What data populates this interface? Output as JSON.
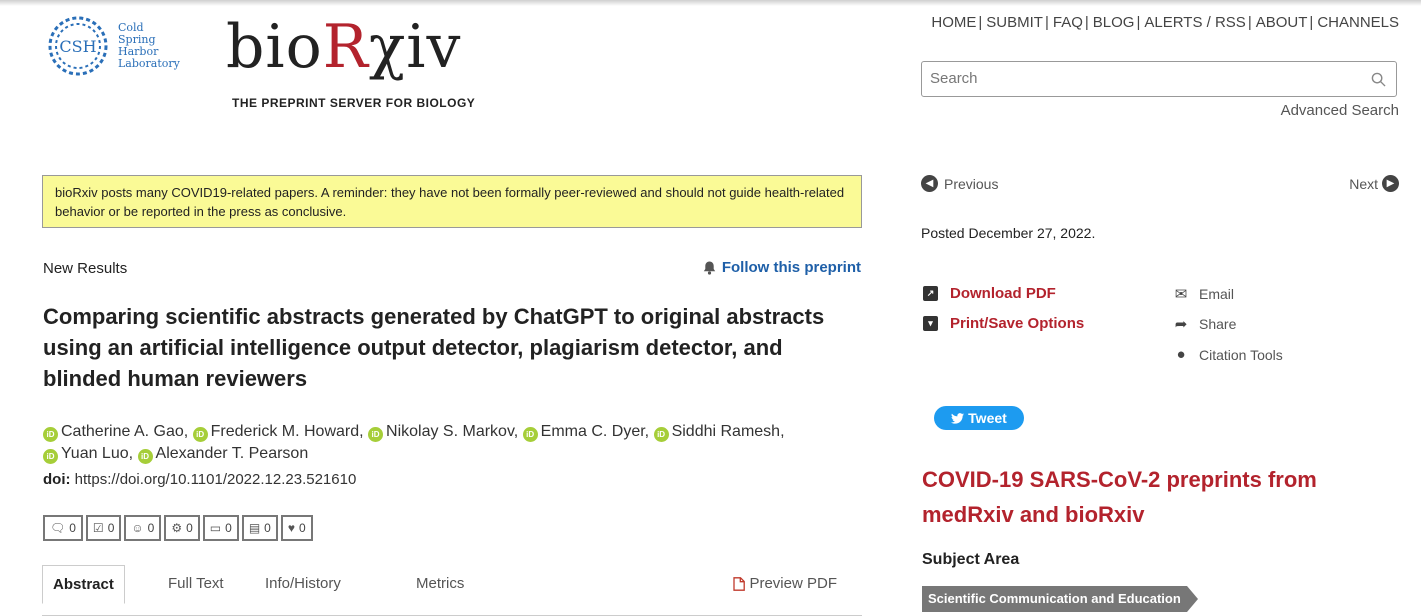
{
  "header": {
    "cshl_lines": [
      "Cold",
      "Spring",
      "Harbor",
      "Laboratory"
    ],
    "cshl_badge": "CSH",
    "brand_pre": "bio",
    "brand_r": "R",
    "brand_post": "χiv",
    "tagline": "THE PREPRINT SERVER FOR BIOLOGY",
    "nav": [
      "HOME",
      "SUBMIT",
      "FAQ",
      "BLOG",
      "ALERTS / RSS",
      "ABOUT",
      "CHANNELS"
    ],
    "search_placeholder": "Search",
    "advanced_search": "Advanced Search"
  },
  "notice": "bioRxiv posts many COVID19-related papers. A reminder: they have not been formally peer-reviewed and should not guide health-related behavior or be reported in the press as conclusive.",
  "article": {
    "type": "New Results",
    "follow": "Follow this preprint",
    "title": "Comparing scientific abstracts generated by ChatGPT to original abstracts using an artificial intelligence output detector, plagiarism detector, and blinded human reviewers",
    "authors": [
      "Catherine A. Gao,",
      "Frederick M. Howard,",
      "Nikolay S. Markov,",
      "Emma C. Dyer,",
      "Siddhi Ramesh,",
      "Yuan Luo,",
      "Alexander T. Pearson"
    ],
    "doi_label": "doi:",
    "doi": "https://doi.org/10.1101/2022.12.23.521610",
    "metrics": [
      "0",
      "0",
      "0",
      "0",
      "0",
      "0",
      "0"
    ],
    "tabs": [
      "Abstract",
      "Full Text",
      "Info/History",
      "Metrics"
    ],
    "preview_pdf": "Preview PDF"
  },
  "sidebar": {
    "previous": "Previous",
    "next": "Next",
    "posted": "Posted December 27, 2022.",
    "download_pdf": "Download PDF",
    "print_save": "Print/Save Options",
    "email": "Email",
    "share": "Share",
    "citation_tools": "Citation Tools",
    "tweet": "Tweet",
    "covid_heading": "COVID-19 SARS-CoV-2 preprints from medRxiv and bioRxiv",
    "subject_label": "Subject Area",
    "subject": "Scientific Communication and Education"
  },
  "colors": {
    "accent_red": "#b3232d",
    "link_blue": "#1e5fa8",
    "notice_bg": "#fafa96",
    "tweet_blue": "#1d9bf0"
  }
}
